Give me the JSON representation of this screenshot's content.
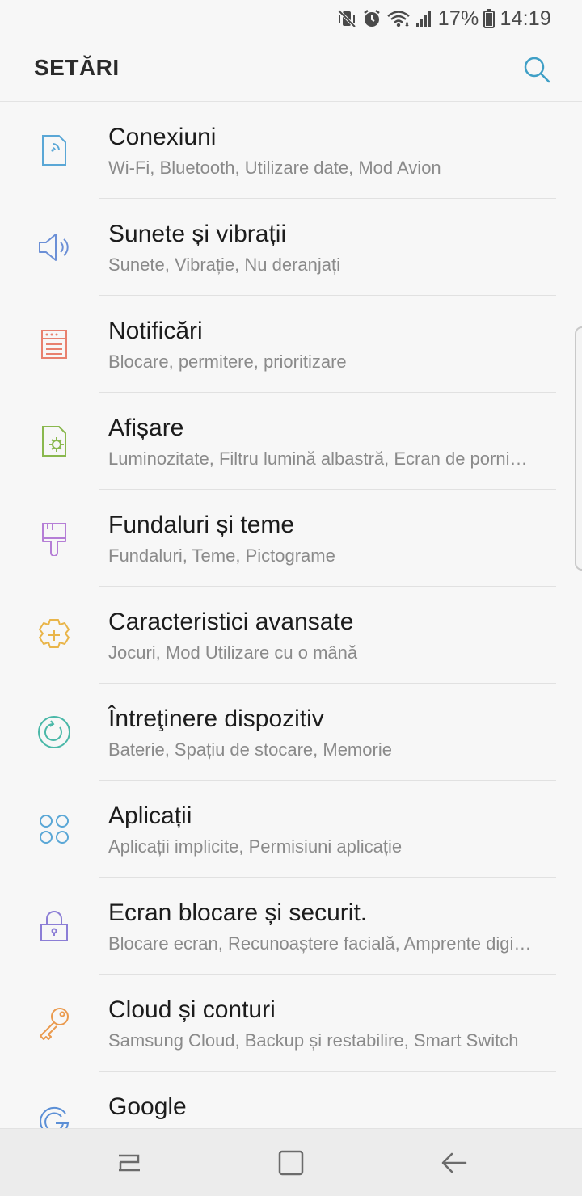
{
  "status_bar": {
    "battery": "17%",
    "time": "14:19",
    "icons": [
      "vibrate-mute-icon",
      "alarm-icon",
      "wifi-icon",
      "signal-icon",
      "battery-icon"
    ]
  },
  "header": {
    "title": "SETĂRI",
    "search_icon": "search-icon"
  },
  "settings": [
    {
      "title": "Conexiuni",
      "subtitle": "Wi-Fi, Bluetooth, Utilizare date, Mod Avion",
      "icon": "connections-icon",
      "color": "#5aa7d6"
    },
    {
      "title": "Sunete și vibrații",
      "subtitle": "Sunete, Vibrație, Nu deranjați",
      "icon": "sound-icon",
      "color": "#6b8fd6"
    },
    {
      "title": "Notificări",
      "subtitle": "Blocare, permitere, prioritizare",
      "icon": "notifications-icon",
      "color": "#e8816f"
    },
    {
      "title": "Afișare",
      "subtitle": "Luminozitate, Filtru lumină albastră, Ecran de porni…",
      "icon": "display-icon",
      "color": "#8ab84e"
    },
    {
      "title": "Fundaluri și teme",
      "subtitle": "Fundaluri, Teme, Pictograme",
      "icon": "themes-icon",
      "color": "#b57ed6"
    },
    {
      "title": "Caracteristici avansate",
      "subtitle": "Jocuri, Mod Utilizare cu o mână",
      "icon": "advanced-features-icon",
      "color": "#e9b54a"
    },
    {
      "title": "Întreţinere dispozitiv",
      "subtitle": "Baterie, Spațiu de stocare, Memorie",
      "icon": "device-maintenance-icon",
      "color": "#4ab8a8"
    },
    {
      "title": "Aplicații",
      "subtitle": "Aplicații implicite, Permisiuni aplicație",
      "icon": "apps-icon",
      "color": "#5aa7d6"
    },
    {
      "title": "Ecran blocare și securit.",
      "subtitle": "Blocare ecran, Recunoaștere facială, Amprente digi…",
      "icon": "lock-icon",
      "color": "#8c7ed6"
    },
    {
      "title": "Cloud și conturi",
      "subtitle": "Samsung Cloud, Backup și restabilire, Smart Switch",
      "icon": "key-icon",
      "color": "#ea9a4e"
    },
    {
      "title": "Google",
      "subtitle": "",
      "icon": "google-icon",
      "color": "#5b8fd6"
    }
  ],
  "nav_bar": {
    "recents_icon": "recents-icon",
    "home_icon": "home-icon",
    "back_icon": "back-icon"
  }
}
